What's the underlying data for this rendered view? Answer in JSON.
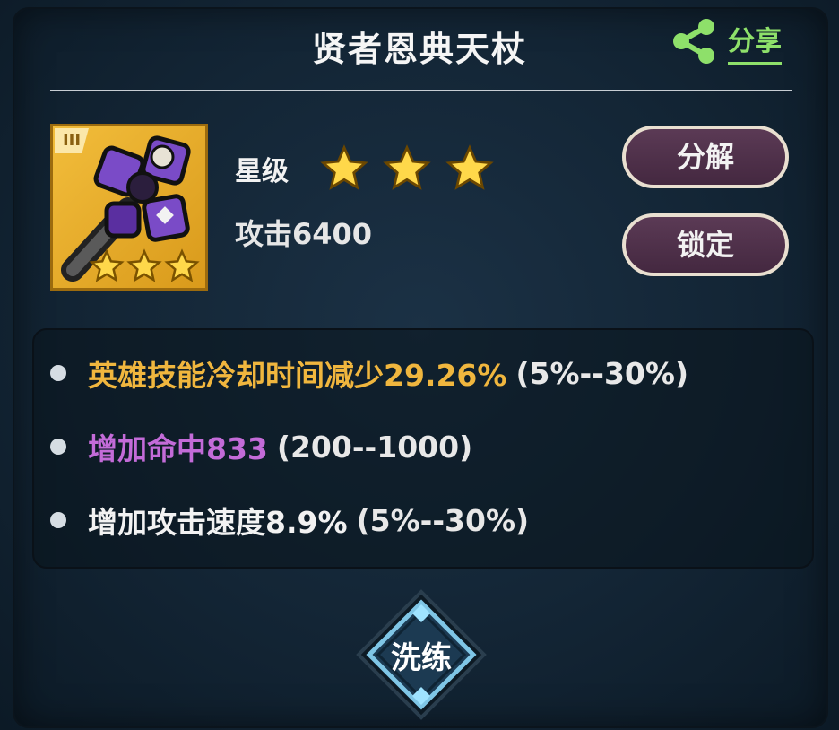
{
  "header": {
    "title": "贤者恩典天杖",
    "share_label": "分享"
  },
  "item": {
    "tier_label": "III",
    "star_label": "星级",
    "stars": 3,
    "attack_label": "攻击6400"
  },
  "actions": {
    "decompose_label": "分解",
    "lock_label": "锁定",
    "refine_label": "洗练"
  },
  "stats": [
    {
      "text": "英雄技能冷却时间减少29.26%",
      "range": "(5%--30%)",
      "color": "#f0b63e"
    },
    {
      "text": "增加命中833",
      "range": "(200--1000)",
      "color": "#c36bd8"
    },
    {
      "text": "增加攻击速度8.9%",
      "range": "(5%--30%)",
      "color": "#f2f2f2"
    }
  ],
  "colors": {
    "accent_green": "#8ee06a",
    "gold": "#f0b63e",
    "purple": "#c36bd8",
    "button_bg": "#4e3049"
  },
  "icons": [
    "share-icon",
    "star-icon",
    "staff-item-icon",
    "diamond-icon"
  ]
}
